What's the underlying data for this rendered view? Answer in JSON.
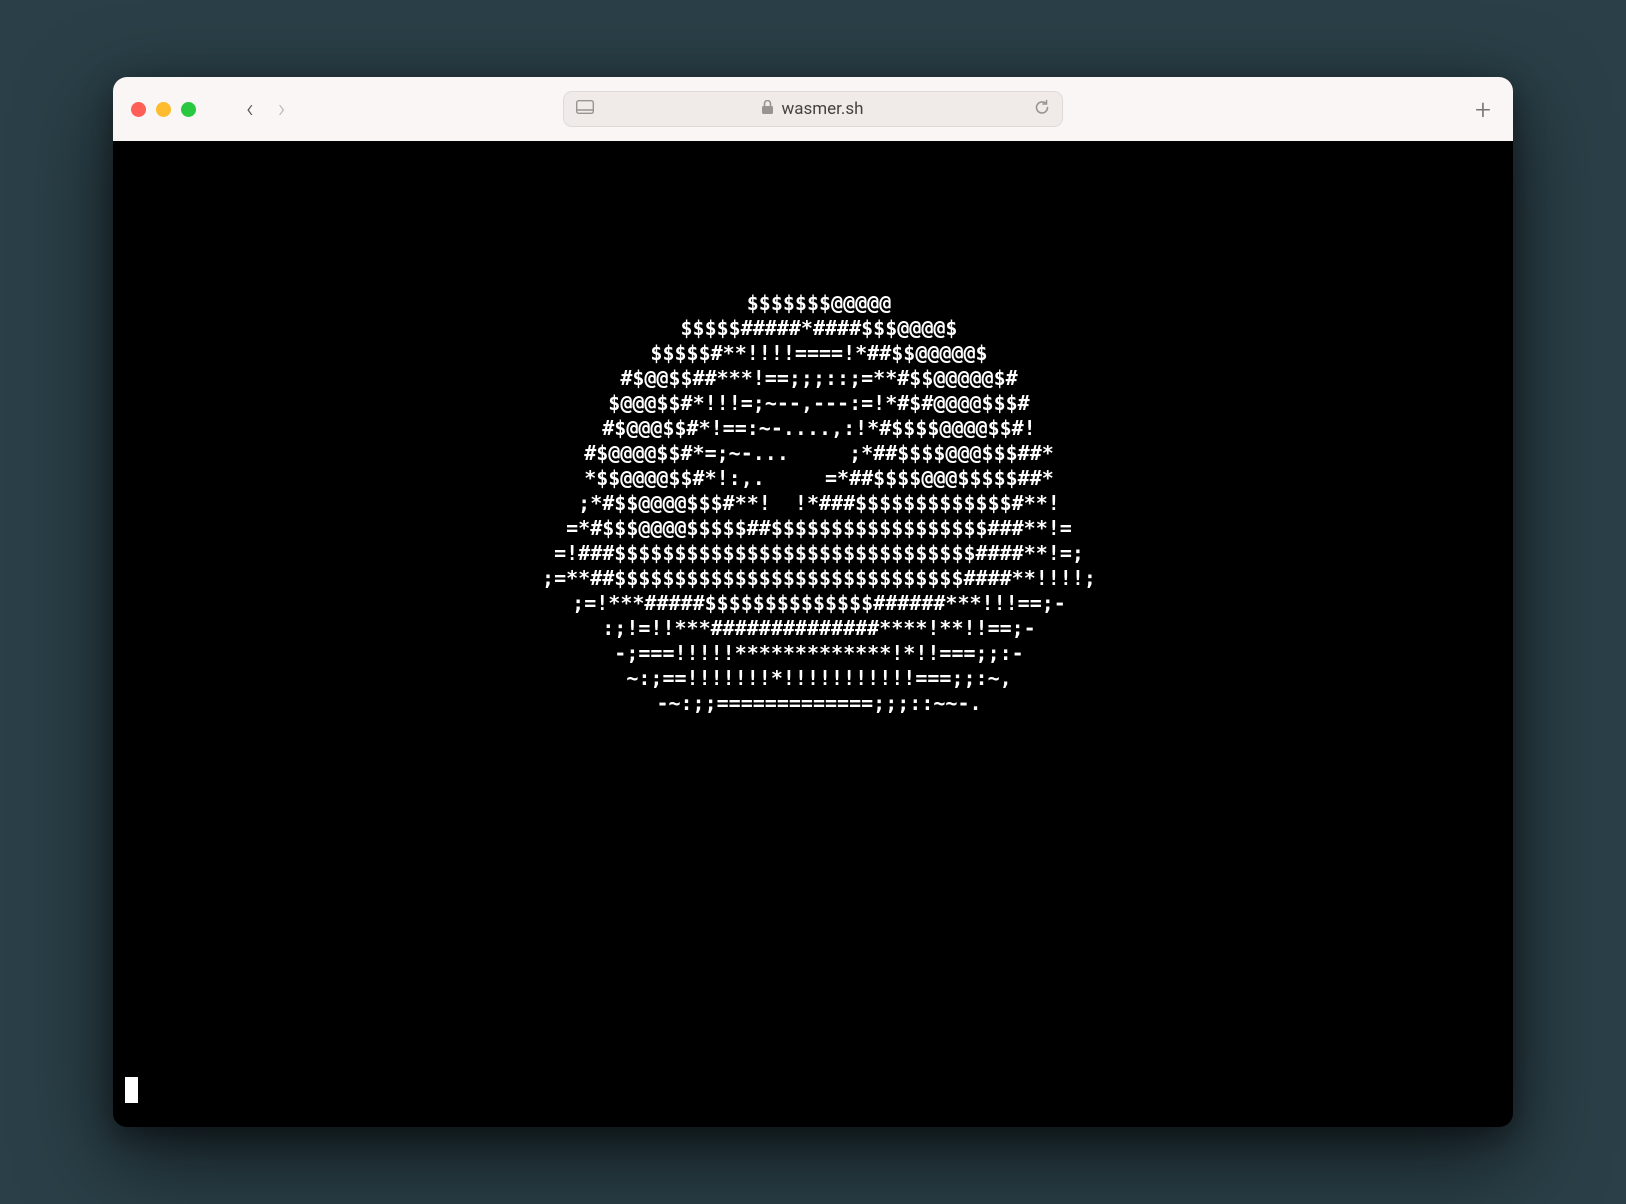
{
  "browser": {
    "url": "wasmer.sh",
    "back_label": "‹",
    "forward_label": "›",
    "newtab_label": "+",
    "reload_label": "↻",
    "sidebar_label": "▭",
    "lock_label": "🔒"
  },
  "terminal": {
    "ascii_lines": [
      "$$$$$$$@@@@@",
      "$$$$$#####*####$$$@@@@$",
      "$$$$$#**!!!!====!*##$$@@@@@$",
      "#$@@$$##***!==;;;::;=**#$$@@@@@$#",
      "$@@@$$#*!!!=;~--,---:=!*#$#@@@@$$$#",
      "#$@@@$$#*!==:~-....,:!*#$$$$@@@@$$#!",
      "#$@@@@$$#*=;~-...     ;*##$$$$@@@$$$##*",
      "*$$@@@@$$#*!:,.     =*##$$$$@@@$$$$$##*",
      ";*#$$@@@@$$$#**!  !*###$$$$$$$$$$$$$#**!",
      "=*#$$$@@@@$$$$$##$$$$$$$$$$$$$$$$$$###**!=",
      "=!###$$$$$$$$$$$$$$$$$$$$$$$$$$$$$$####**!=;",
      ";=**##$$$$$$$$$$$$$$$$$$$$$$$$$$$$$####**!!!!;",
      ";=!***#####$$$$$$$$$$$$$$######***!!!==;-",
      ":;!=!!***##############****!**!!==;-",
      "-;===!!!!!*************!*!!===;;:-",
      "~:;==!!!!!!!*!!!!!!!!!!!===;;:~,",
      "-~:;;=============;;;::~~-."
    ]
  }
}
